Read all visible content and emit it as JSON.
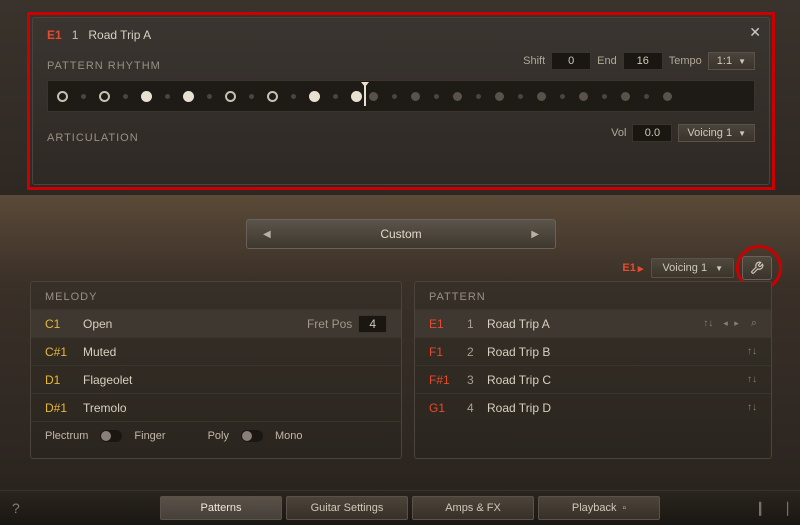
{
  "top": {
    "key": "E1",
    "num": "1",
    "name": "Road Trip A",
    "rhythm_label": "PATTERN RHYTHM",
    "shift_label": "Shift",
    "shift_val": "0",
    "end_label": "End",
    "end_val": "16",
    "tempo_label": "Tempo",
    "tempo_val": "1:1",
    "artic_label": "ARTICULATION",
    "vol_label": "Vol",
    "vol_val": "0.0",
    "voicing": "Voicing 1"
  },
  "selector": {
    "value": "Custom"
  },
  "right_upper": {
    "key": "E1",
    "voicing": "Voicing 1"
  },
  "melody": {
    "title": "MELODY",
    "rows": [
      {
        "key": "C1",
        "name": "Open",
        "pos_label": "Fret Pos",
        "pos_val": "4"
      },
      {
        "key": "C#1",
        "name": "Muted"
      },
      {
        "key": "D1",
        "name": "Flageolet"
      },
      {
        "key": "D#1",
        "name": "Tremolo"
      }
    ],
    "toggles": {
      "plectrum": "Plectrum",
      "finger": "Finger",
      "poly": "Poly",
      "mono": "Mono"
    }
  },
  "pattern": {
    "title": "PATTERN",
    "rows": [
      {
        "key": "E1",
        "num": "1",
        "name": "Road Trip A"
      },
      {
        "key": "F1",
        "num": "2",
        "name": "Road Trip B"
      },
      {
        "key": "F#1",
        "num": "3",
        "name": "Road Trip C"
      },
      {
        "key": "G1",
        "num": "4",
        "name": "Road Trip D"
      }
    ]
  },
  "bottom": {
    "tabs": [
      "Patterns",
      "Guitar Settings",
      "Amps & FX",
      "Playback"
    ]
  }
}
